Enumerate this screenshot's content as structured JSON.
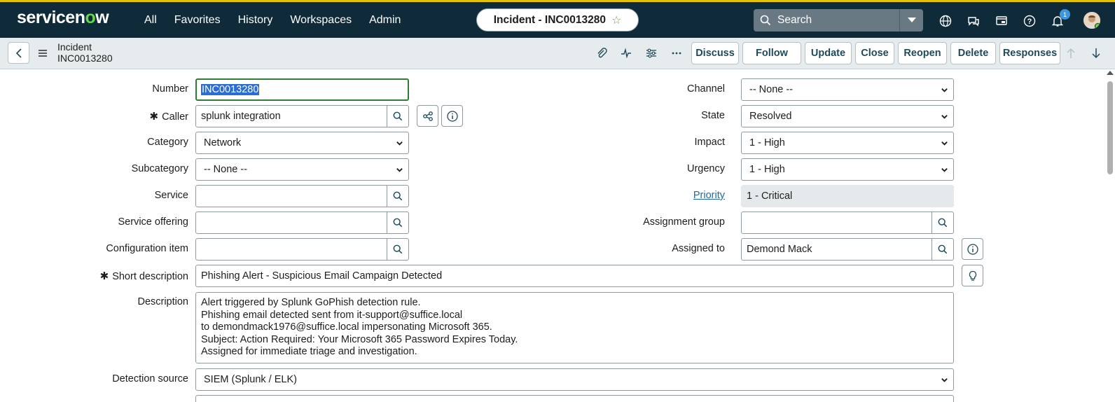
{
  "header": {
    "logo_text_a": "servicen",
    "logo_text_b": "o",
    "logo_text_c": "w",
    "nav": [
      "All",
      "Favorites",
      "History",
      "Workspaces",
      "Admin"
    ],
    "record_title": "Incident - INC0013280",
    "search_placeholder": "Search",
    "notification_count": "1"
  },
  "subbar": {
    "record_type": "Incident",
    "record_number": "INC0013280",
    "buttons": [
      "Discuss",
      "Follow",
      "Update",
      "Close",
      "Reopen",
      "Delete",
      "Responses"
    ]
  },
  "form": {
    "number": {
      "label": "Number",
      "value": "INC0013280"
    },
    "caller": {
      "label": "Caller",
      "value": "splunk integration"
    },
    "category": {
      "label": "Category",
      "value": "Network"
    },
    "subcategory": {
      "label": "Subcategory",
      "value": "-- None --"
    },
    "service": {
      "label": "Service",
      "value": ""
    },
    "service_offering": {
      "label": "Service offering",
      "value": ""
    },
    "configuration_item": {
      "label": "Configuration item",
      "value": ""
    },
    "channel": {
      "label": "Channel",
      "value": "-- None --"
    },
    "state": {
      "label": "State",
      "value": "Resolved"
    },
    "impact": {
      "label": "Impact",
      "value": "1 - High"
    },
    "urgency": {
      "label": "Urgency",
      "value": "1 - High"
    },
    "priority": {
      "label": "Priority",
      "value": "1 - Critical"
    },
    "assignment_group": {
      "label": "Assignment group",
      "value": ""
    },
    "assigned_to": {
      "label": "Assigned to",
      "value": "Demond Mack"
    },
    "short_description": {
      "label": "Short description",
      "value": "Phishing Alert - Suspicious Email Campaign Detected"
    },
    "description": {
      "label": "Description",
      "lines": [
        "Alert triggered by Splunk GoPhish detection rule.",
        "Phishing email detected sent from it-support@suffice.local",
        "to demondmack1976@suffice.local impersonating Microsoft 365.",
        "Subject: Action Required: Your Microsoft 365 Password Expires Today.",
        "Assigned for immediate triage and investigation."
      ]
    },
    "detection_source": {
      "label": "Detection source",
      "value": "SIEM (Splunk / ELK)"
    }
  },
  "colors": {
    "nav_bg": "#0f2a38",
    "accent_green": "#62d84e",
    "subbar_bg": "#e6ecee",
    "readonly_bg": "#e4eaec",
    "link": "#1f6aa5",
    "focus_border": "#2e7d32",
    "selection": "#2a6dd6"
  }
}
